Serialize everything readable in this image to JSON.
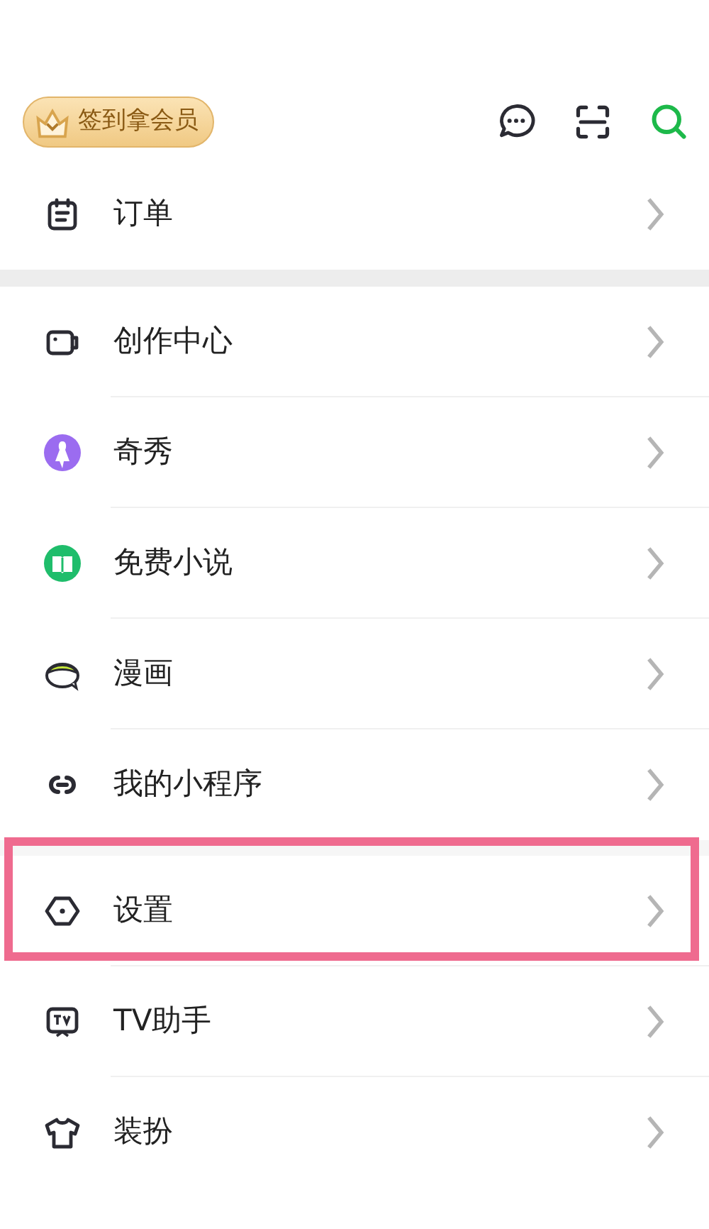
{
  "header": {
    "checkin_badge": "签到拿会员"
  },
  "groups": [
    {
      "items": [
        {
          "label": "订单",
          "highlighted": false
        }
      ]
    },
    {
      "items": [
        {
          "label": "创作中心",
          "highlighted": false
        },
        {
          "label": "奇秀",
          "highlighted": false
        },
        {
          "label": "免费小说",
          "highlighted": false
        },
        {
          "label": "漫画",
          "highlighted": false
        },
        {
          "label": "我的小程序",
          "highlighted": false
        }
      ]
    },
    {
      "items": [
        {
          "label": "设置",
          "highlighted": true
        },
        {
          "label": "TV助手",
          "highlighted": false
        },
        {
          "label": "装扮",
          "highlighted": false
        }
      ]
    }
  ]
}
